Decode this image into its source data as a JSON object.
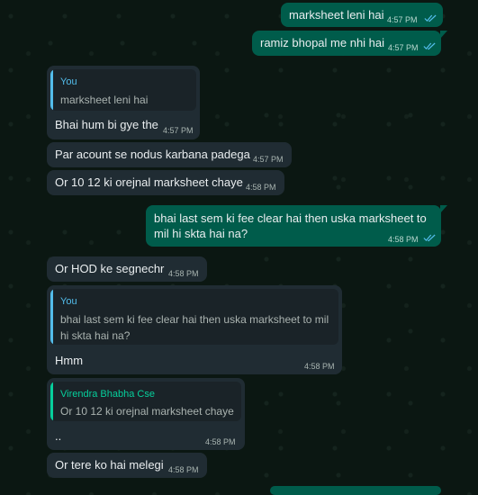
{
  "theme": {
    "incoming_bubble": "#202c33",
    "outgoing_bubble": "#005c4b",
    "you_accent": "#53bdeb",
    "sender_accent": "#06cf9c",
    "read_ticks": "#53bdeb"
  },
  "messages": [
    {
      "text": "marksheet leni hai",
      "time": "4:57 PM",
      "status": "read-double-check-icon"
    },
    {
      "text": "ramiz bhopal me nhi hai",
      "time": "4:57 PM",
      "status": "read-double-check-icon"
    },
    {
      "quote_author": "You",
      "quote_text": "marksheet leni hai",
      "text": "Bhai hum bi gye the",
      "time": "4:57 PM"
    },
    {
      "text": "Par acount se nodus karbana padega",
      "time": "4:57 PM"
    },
    {
      "text": "Or 10 12 ki orejnal marksheet chaye",
      "time": "4:58 PM"
    },
    {
      "text_line1": "bhai last sem ki fee clear hai then uska marksheet to",
      "text_line2": "mil hi skta hai na?",
      "time": "4:58 PM",
      "status": "read-double-check-icon"
    },
    {
      "text": "Or HOD ke segnechr",
      "time": "4:58 PM"
    },
    {
      "quote_author": "You",
      "quote_line1": "bhai last sem ki fee clear hai then uska marksheet to mil",
      "quote_line2": "hi skta hai na?",
      "text": "Hmm",
      "time": "4:58 PM"
    },
    {
      "quote_author": "Virendra Bhabha Cse",
      "quote_text": "Or 10 12 ki orejnal marksheet chaye",
      "text": "..",
      "time": "4:58 PM"
    },
    {
      "text": "Or tere ko hai melegi",
      "time": "4:58 PM"
    }
  ]
}
